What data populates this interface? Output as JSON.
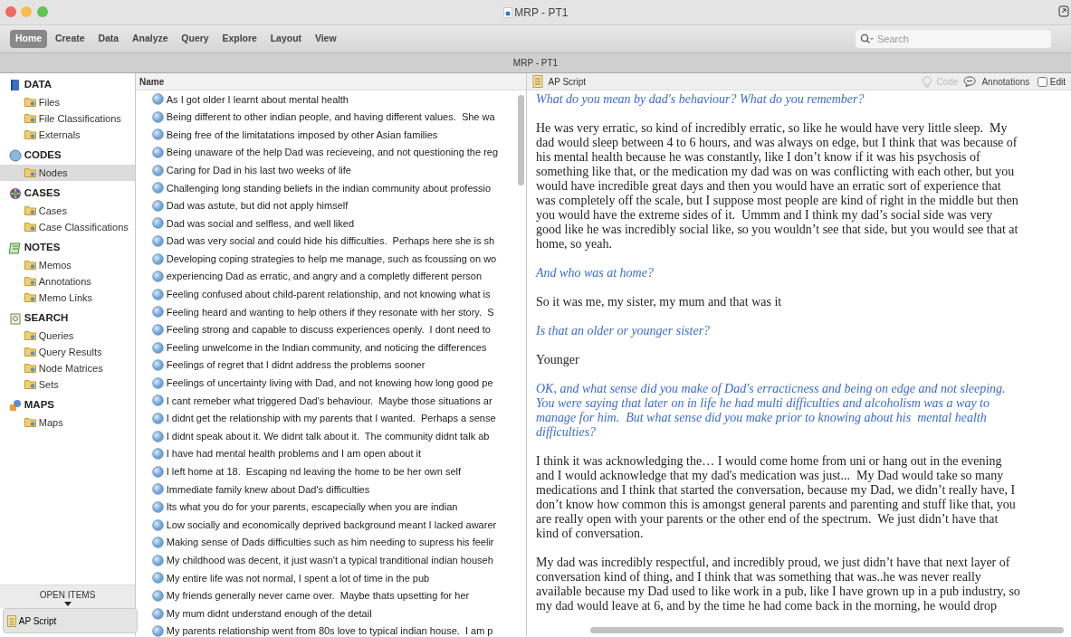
{
  "window": {
    "title": "MRP - PT1"
  },
  "ribbon_tabs": [
    {
      "label": "Home",
      "selected": true
    },
    {
      "label": "Create",
      "selected": false
    },
    {
      "label": "Data",
      "selected": false
    },
    {
      "label": "Analyze",
      "selected": false
    },
    {
      "label": "Query",
      "selected": false
    },
    {
      "label": "Explore",
      "selected": false
    },
    {
      "label": "Layout",
      "selected": false
    },
    {
      "label": "View",
      "selected": false
    }
  ],
  "search": {
    "placeholder": "Search"
  },
  "project_title": "MRP - PT1",
  "sidebar": {
    "sections": [
      {
        "title": "DATA",
        "items": [
          {
            "label": "Files",
            "selected": false
          },
          {
            "label": "File Classifications",
            "selected": false
          },
          {
            "label": "Externals",
            "selected": false
          }
        ]
      },
      {
        "title": "CODES",
        "items": [
          {
            "label": "Nodes",
            "selected": true
          }
        ]
      },
      {
        "title": "CASES",
        "items": [
          {
            "label": "Cases",
            "selected": false
          },
          {
            "label": "Case Classifications",
            "selected": false
          }
        ]
      },
      {
        "title": "NOTES",
        "items": [
          {
            "label": "Memos",
            "selected": false
          },
          {
            "label": "Annotations",
            "selected": false
          },
          {
            "label": "Memo Links",
            "selected": false
          }
        ]
      },
      {
        "title": "SEARCH",
        "items": [
          {
            "label": "Queries",
            "selected": false
          },
          {
            "label": "Query Results",
            "selected": false
          },
          {
            "label": "Node Matrices",
            "selected": false
          },
          {
            "label": "Sets",
            "selected": false
          }
        ]
      },
      {
        "title": "MAPS",
        "items": [
          {
            "label": "Maps",
            "selected": false
          }
        ]
      }
    ],
    "open_items_label": "OPEN ITEMS",
    "open_items": [
      "AP Script"
    ]
  },
  "nodes": {
    "column": "Name",
    "rows": [
      "As I got older I learnt about mental health",
      "Being different to other indian people, and having different values.  She wa",
      "Being free of the limitatations imposed by other Asian families",
      "Being unaware of the help Dad was recieveing, and not questioning the reg",
      "Caring for Dad in his last two weeks of life",
      "Challenging long standing beliefs in the indian community about professio",
      "Dad was astute, but did not apply himself",
      "Dad was social and selfless, and well liked",
      "Dad was very social and could hide his difficulties.  Perhaps here she is sh",
      "Developing coping strategies to help me manage, such as fcoussing on wo",
      "experiencing Dad as erratic, and angry and a completly different person",
      "Feeling confused about child-parent relationship, and not knowing what is",
      "Feeling heard and wanting to help others if they resonate with her story.  S",
      "Feeling strong and capable to discuss experiences openly.  I dont need to",
      "Feeling unwelcome in the Indian community, and noticing the differences",
      "Feelings of regret that I didnt address the problems sooner",
      "Feelings of uncertainty living with Dad, and not knowing how long good pe",
      "I cant remeber what triggered Dad's behaviour.  Maybe those situations ar",
      "I didnt get the relationship with my parents that I wanted.  Perhaps a sense",
      "I didnt speak about it. We didnt talk about it.  The community didnt talk ab",
      "I have had mental health problems and I am open about it",
      "I left home at 18.  Escaping nd leaving the home to be her own self",
      "Immediate family knew about Dad's difficulties",
      "Its what you do for your parents, escapecially when you are indian",
      "Low socially and economically deprived background meant I lacked awarer",
      "Making sense of Dads difficulties such as him needing to supress his feelir",
      "My childhood was decent, it just wasn't a typical tranditional indian househ",
      "My entire life was not normal, I spent a lot of time in the pub",
      "My friends generally never came over.  Maybe thats upsetting for her",
      "My mum didnt understand enough of the detail",
      "My parents relationship went from 80s love to typical indian house.  I am p"
    ]
  },
  "document": {
    "title": "AP Script",
    "code_button": {
      "label": "Code",
      "disabled": true
    },
    "annotations_button": "Annotations",
    "edit": {
      "label": "Edit",
      "checked": false
    },
    "paragraphs": [
      {
        "kind": "question",
        "text": "What do you mean by dad's behaviour? What do you remember?"
      },
      {
        "kind": "answer",
        "text": "He was very erratic, so kind of incredibly erratic, so like he would have very little sleep.  My dad would sleep between 4 to 6 hours, and was always on edge, but I think that was because of his mental health because he was constantly, like I don’t know if it was his psychosis of something like that, or the medication my dad was on was conflicting with each other, but you would have incredible great days and then you would have an erratic sort of experience that was completely off the scale, but I suppose most people are kind of right in the middle but then you would have the extreme sides of it.  Ummm and I think my dad’s social side was very good like he was incredibly social like, so you wouldn’t see that side, but you would see that at home, so yeah."
      },
      {
        "kind": "question",
        "text": "And who was at home?"
      },
      {
        "kind": "answer",
        "text": "So it was me, my sister, my mum and that was it"
      },
      {
        "kind": "question",
        "text": "Is that an older or younger sister?"
      },
      {
        "kind": "answer",
        "text": "Younger"
      },
      {
        "kind": "question",
        "text": "OK, and what sense did you make of Dad's erracticness and being on edge and not sleeping.  You were saying that later on in life he had multi difficulties and alcoholism was a way to manage for him.  But what sense did you make prior to knowing about his  mental health difficulties?"
      },
      {
        "kind": "answer",
        "text": "I think it was acknowledging the… I would come home from uni or hang out in the evening and I would acknowledge that my dad's medication was just...  My Dad would take so many medications and I think that started the conversation, because my Dad, we didn’t really have, I don’t know how common this is amongst general parents and parenting and stuff like that, you are really open with your parents or the other end of the spectrum.  We just didn’t have that kind of conversation."
      },
      {
        "kind": "answer",
        "text": "My dad was incredibly respectful, and incredibly proud, we just didn’t have that next layer of conversation kind of thing, and I think that was something that was..he was never really available because my Dad used to like work in a pub, like I have grown up in a pub industry, so my dad would leave at 6, and by the time he had come back in the morning, he would drop"
      }
    ]
  }
}
